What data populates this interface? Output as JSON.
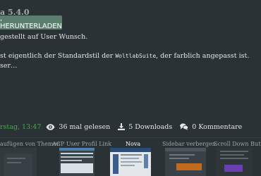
{
  "version": "a 5.4.0",
  "download_button": {
    "label": ", HERUNTERLADEN"
  },
  "description": {
    "line1": "gestellt auf User Wunsch.",
    "line2_prefix": "st eigentlich der Standardstil der ",
    "line2_code": "WoltlabSuite",
    "line2_suffix": ", der farblich angepasst ist.",
    "line3": "ser…"
  },
  "meta": {
    "date": "rstag, 13:47",
    "views": "36 mal gelesen",
    "downloads": "5 Downloads",
    "comments": "0 Kommentare"
  },
  "related": {
    "items": [
      {
        "label": "aufügen von Themen"
      },
      {
        "label": "ACP User Profil Link"
      },
      {
        "label": "Nova",
        "active": true
      },
      {
        "label": "Sidebar verbergen"
      },
      {
        "label": "Scroll Down Button"
      }
    ]
  },
  "colors": {
    "background": "#2b3236",
    "button": "#5b7e6f",
    "date": "#4fa356"
  },
  "icons": {
    "views": "eye-icon",
    "downloads": "download-icon",
    "comments": "comments-icon"
  }
}
